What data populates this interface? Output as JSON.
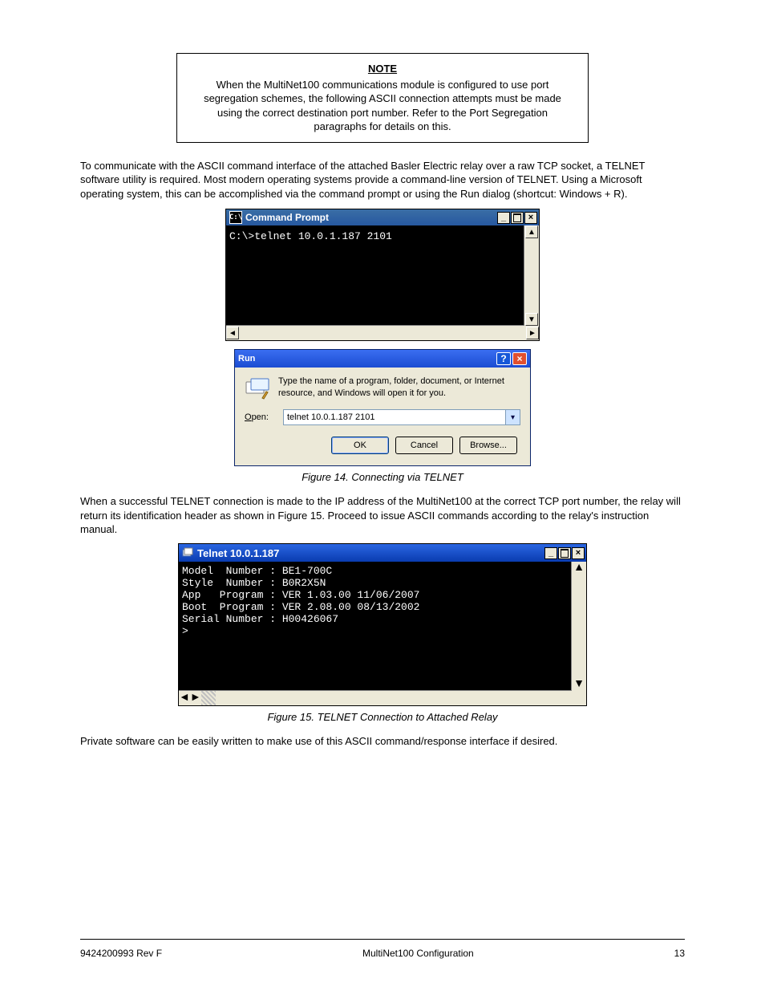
{
  "note": {
    "title": "NOTE",
    "text": "When the MultiNet100 communications module is configured to use port segregation schemes, the following ASCII connection attempts must be made using the correct destination port number. Refer to the Port Segregation paragraphs for details on this."
  },
  "paragraph1": "To communicate with the ASCII command interface of the attached Basler Electric relay over a raw TCP socket, a TELNET software utility is required. Most modern operating systems provide a command-line version of TELNET. Using a Microsoft operating system, this can be accomplished via the command prompt or using the Run dialog (shortcut: Windows + R).",
  "figcaptions": {
    "fig14": "Figure 14. Connecting via TELNET",
    "fig15": "Figure 15. TELNET Connection to Attached Relay"
  },
  "paragraph2": "When a successful TELNET connection is made to the IP address of the MultiNet100 at the correct TCP port number, the relay will return its identification header as shown in Figure 15. Proceed to issue ASCII commands according to the relay's instruction manual.",
  "paragraph3": "Private software can be easily written to make use of this ASCII command/response interface if desired.",
  "cmd": {
    "title": "Command Prompt",
    "icon_text": "C:\\",
    "line": "C:\\>telnet 10.0.1.187 2101"
  },
  "run": {
    "title": "Run",
    "desc": "Type the name of a program, folder, document, or Internet resource, and Windows will open it for you.",
    "open_label_u": "O",
    "open_label_rest": "pen:",
    "open_value": "telnet 10.0.1.187 2101",
    "ok": "OK",
    "cancel": "Cancel",
    "browse": "Browse..."
  },
  "telnet": {
    "title": "Telnet 10.0.1.187",
    "lines": "Model  Number : BE1-700C\nStyle  Number : B0R2X5N\nApp   Program : VER 1.03.00 11/06/2007\nBoot  Program : VER 2.08.00 08/13/2002\nSerial Number : H00426067\n>"
  },
  "footer": {
    "left": "9424200993 Rev F",
    "center": "MultiNet100 Configuration",
    "right": "13"
  }
}
